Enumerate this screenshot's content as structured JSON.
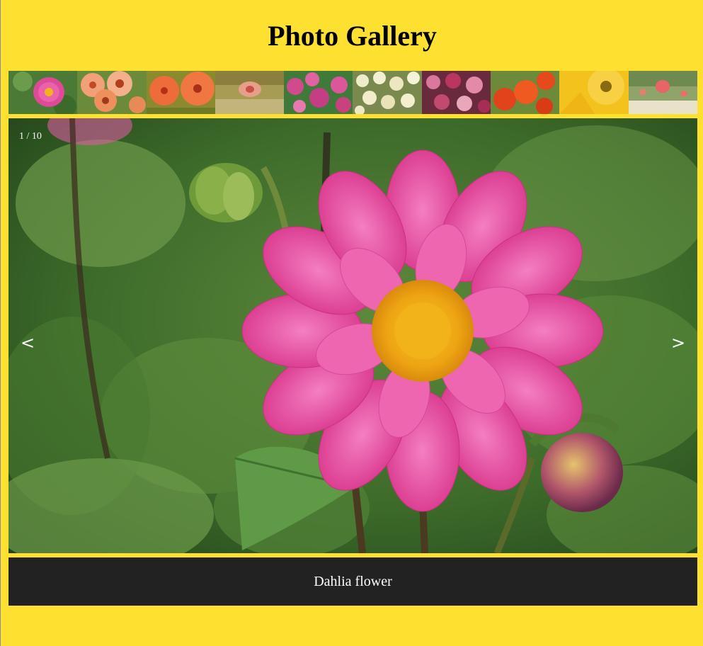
{
  "header": {
    "title": "Photo Gallery"
  },
  "gallery": {
    "counter": "1 / 10",
    "prev_label": "<",
    "next_label": ">",
    "caption": "Dahlia flower",
    "thumbnails": [
      {
        "name": "thumb-dahlia-pink",
        "tone": "#d8438b"
      },
      {
        "name": "thumb-gazania-orange",
        "tone": "#ee8a57"
      },
      {
        "name": "thumb-hibiscus-orange",
        "tone": "#ec6a37"
      },
      {
        "name": "thumb-lily-pale",
        "tone": "#c9b07b"
      },
      {
        "name": "thumb-petunia-magenta",
        "tone": "#c0448a"
      },
      {
        "name": "thumb-white-blossoms",
        "tone": "#e8e6c3"
      },
      {
        "name": "thumb-dianthus-dark-pink",
        "tone": "#9b2b57"
      },
      {
        "name": "thumb-roses-red-orange",
        "tone": "#e54b1a"
      },
      {
        "name": "thumb-yellow-sunflower",
        "tone": "#f2c31b"
      },
      {
        "name": "thumb-tulips-field",
        "tone": "#e56f73"
      }
    ]
  },
  "colors": {
    "background": "#fde030",
    "caption_bar": "#222222",
    "caption_text": "#ffffff"
  }
}
